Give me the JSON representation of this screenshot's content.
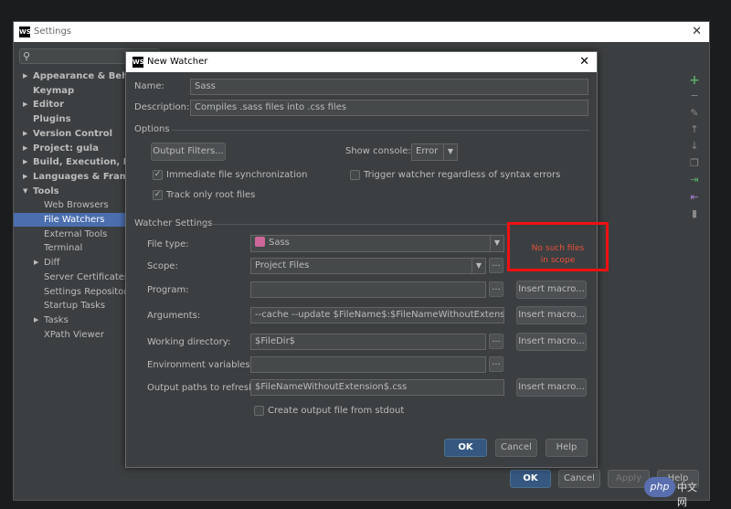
{
  "settings": {
    "title": "Settings",
    "tree": [
      {
        "label": "Appearance & Behavior",
        "bold": true,
        "arrow": true
      },
      {
        "label": "Keymap",
        "bold": true,
        "arrow": false
      },
      {
        "label": "Editor",
        "bold": true,
        "arrow": true
      },
      {
        "label": "Plugins",
        "bold": true,
        "arrow": false
      },
      {
        "label": "Version Control",
        "bold": true,
        "arrow": true
      },
      {
        "label": "Project: gula",
        "bold": true,
        "arrow": true
      },
      {
        "label": "Build, Execution, Deployment",
        "bold": true,
        "arrow": true
      },
      {
        "label": "Languages & Frameworks",
        "bold": true,
        "arrow": true
      },
      {
        "label": "Tools",
        "bold": true,
        "arrow": true,
        "expanded": true
      },
      {
        "label": "Web Browsers",
        "bold": false,
        "arrow": false
      },
      {
        "label": "File Watchers",
        "bold": false,
        "arrow": false,
        "selected": true
      },
      {
        "label": "External Tools",
        "bold": false,
        "arrow": false
      },
      {
        "label": "Terminal",
        "bold": false,
        "arrow": false
      },
      {
        "label": "Diff",
        "bold": false,
        "arrow": true
      },
      {
        "label": "Server Certificates",
        "bold": false,
        "arrow": false
      },
      {
        "label": "Settings Repository",
        "bold": false,
        "arrow": false
      },
      {
        "label": "Startup Tasks",
        "bold": false,
        "arrow": false
      },
      {
        "label": "Tasks",
        "bold": false,
        "arrow": true
      },
      {
        "label": "XPath Viewer",
        "bold": false,
        "arrow": false
      }
    ],
    "footer": {
      "ok": "OK",
      "cancel": "Cancel",
      "apply": "Apply",
      "help": "Help"
    }
  },
  "dialog": {
    "title": "New Watcher",
    "name_label": "Name:",
    "name_value": "Sass",
    "description_label": "Description:",
    "description_value": "Compiles .sass files into .css files",
    "options_header": "Options",
    "output_filters_button": "Output Filters...",
    "show_console_label": "Show console:",
    "show_console_value": "Error",
    "immediate_sync_label": "Immediate file synchronization",
    "trigger_watcher_label": "Trigger watcher regardless of syntax errors",
    "track_root_label": "Track only root files",
    "watcher_settings_header": "Watcher Settings",
    "file_type_label": "File type:",
    "file_type_value": "Sass",
    "scope_label": "Scope:",
    "scope_value": "Project Files",
    "dots": "...",
    "program_label": "Program:",
    "program_value": "",
    "arguments_label": "Arguments:",
    "arguments_value": "--cache --update $FileName$:$FileNameWithoutExtension$.css",
    "working_dir_label": "Working directory:",
    "working_dir_value": "$FileDir$",
    "env_vars_label": "Environment variables:",
    "env_vars_value": "",
    "output_paths_label": "Output paths to refresh:",
    "output_paths_value": "$FileNameWithoutExtension$.css",
    "insert_macro": "Insert macro...",
    "create_output_label": "Create output file from stdout",
    "ok": "OK",
    "cancel": "Cancel",
    "help": "Help"
  },
  "annotation": {
    "line1": "No such files",
    "line2": "in scope",
    "color": "#ee1111"
  },
  "watermark": {
    "logo": "php",
    "text": "中文网"
  }
}
